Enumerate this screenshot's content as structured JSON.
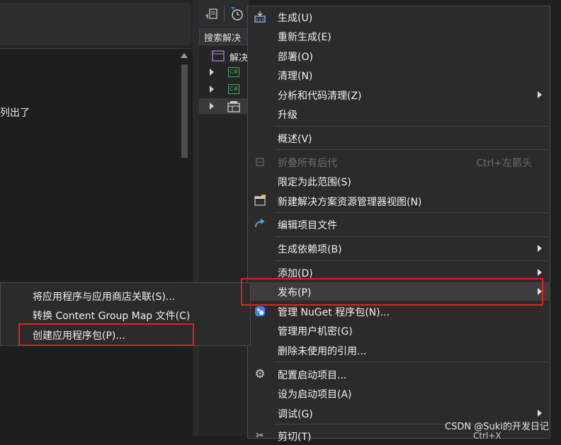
{
  "left_pane": {
    "text": "列出了"
  },
  "solution_explorer": {
    "search_placeholder": "搜索解决",
    "solution_label": "解决"
  },
  "context_menu": {
    "items": [
      {
        "label": "生成(U)",
        "icon": "build-icon"
      },
      {
        "label": "重新生成(E)"
      },
      {
        "label": "部署(O)"
      },
      {
        "label": "清理(N)"
      },
      {
        "label": "分析和代码清理(Z)",
        "submenu": true
      },
      {
        "label": "升级"
      },
      {
        "label": "概述(V)"
      },
      {
        "label": "折叠所有后代",
        "shortcut": "Ctrl+左箭头",
        "disabled": true,
        "icon": "collapse-icon"
      },
      {
        "label": "限定为此范围(S)"
      },
      {
        "label": "新建解决方案资源管理器视图(N)",
        "icon": "new-view-icon"
      },
      {
        "label": "编辑项目文件",
        "icon": "edit-redo-icon"
      },
      {
        "label": "生成依赖项(B)",
        "submenu": true
      },
      {
        "label": "添加(D)",
        "submenu": true
      },
      {
        "label": "发布(P)",
        "submenu": true
      },
      {
        "label": "管理 NuGet 程序包(N)...",
        "icon": "nuget-icon"
      },
      {
        "label": "管理用户机密(G)"
      },
      {
        "label": "删除未使用的引用..."
      },
      {
        "label": "配置启动项目...",
        "icon": "gear-icon"
      },
      {
        "label": "设为启动项目(A)"
      },
      {
        "label": "调试(G)",
        "submenu": true
      },
      {
        "label": "剪切(T)",
        "icon": "scissors-icon"
      }
    ]
  },
  "publish_submenu": {
    "items": [
      {
        "label": "将应用程序与应用商店关联(S)..."
      },
      {
        "label": "转换 Content Group Map 文件(C)"
      },
      {
        "label": "创建应用程序包(P)..."
      }
    ]
  },
  "watermark": {
    "text": "CSDN @Suki的开发日记",
    "partial_shortcut": "Ctrl+X"
  },
  "colors": {
    "highlight_box": "#e02121",
    "menu_bg": "#2b2b2b",
    "nuget_blue": "#3b82f6"
  }
}
